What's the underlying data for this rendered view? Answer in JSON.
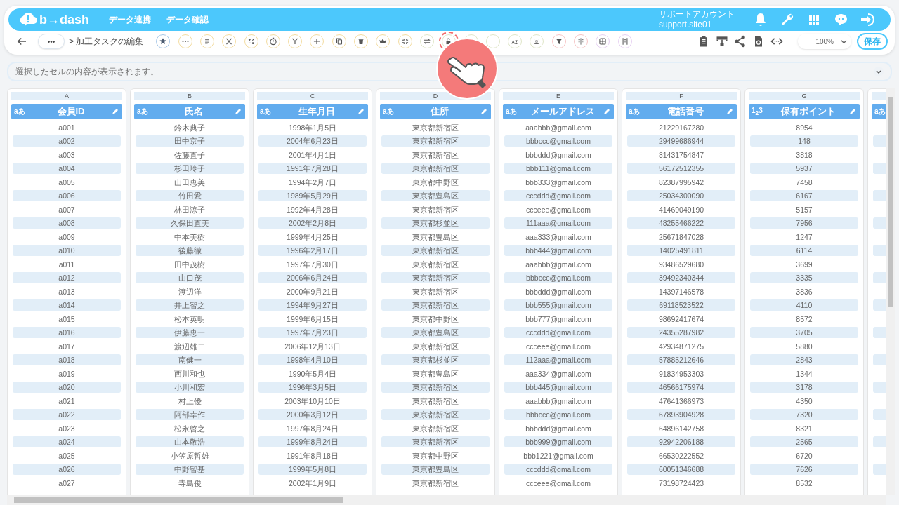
{
  "header": {
    "logo": "b→dash",
    "nav": [
      "データ連携",
      "データ確認"
    ],
    "account": {
      "name": "サポートアカウント",
      "id": "support.site01"
    },
    "icons": [
      {
        "kind": "bell"
      },
      {
        "kind": "wrench"
      },
      {
        "kind": "apps"
      },
      {
        "kind": "chat"
      },
      {
        "kind": "logout"
      }
    ]
  },
  "toolbar": {
    "more": "•••",
    "breadcrumb": "> 加工タスクの編集",
    "tools": [
      {
        "kind": "star",
        "color": "#a8c8e8",
        "highlighted": false
      },
      {
        "kind": "dots",
        "color": "#f3dca0",
        "highlighted": false
      },
      {
        "kind": "lines",
        "color": "#f3dca0",
        "highlighted": false
      },
      {
        "kind": "scissors",
        "color": "#f3dca0",
        "highlighted": false
      },
      {
        "kind": "calc",
        "color": "#f3dca0",
        "highlighted": false
      },
      {
        "kind": "timer",
        "color": "#f3dca0",
        "highlighted": false
      },
      {
        "kind": "merge",
        "color": "#f3dca0",
        "highlighted": false
      },
      {
        "kind": "plus",
        "color": "#f3dca0",
        "highlighted": false
      },
      {
        "kind": "copy",
        "color": "#f3dca0",
        "highlighted": false
      },
      {
        "kind": "trash",
        "color": "#f3dca0",
        "highlighted": false
      },
      {
        "kind": "crown",
        "color": "#f3dca0",
        "highlighted": false
      },
      {
        "kind": "collapse",
        "color": "#f3dca0",
        "highlighted": false
      },
      {
        "kind": "swap",
        "color": "#dfe6c8",
        "highlighted": false
      },
      {
        "kind": "lock",
        "color": "#dfe6c8",
        "highlighted": true
      },
      {
        "kind": "blank",
        "color": "#dfe6c8",
        "highlighted": false
      },
      {
        "kind": "blank",
        "color": "#dfe6c8",
        "highlighted": false
      },
      {
        "kind": "az",
        "color": "#dfe6c8",
        "highlighted": false
      },
      {
        "kind": "box",
        "color": "#dfe6c8",
        "highlighted": false
      },
      {
        "kind": "filter",
        "color": "#f6c4c4",
        "highlighted": false
      },
      {
        "kind": "split",
        "color": "#f6c4c4",
        "highlighted": false
      },
      {
        "kind": "grid",
        "color": "#e6d0f2",
        "highlighted": false
      },
      {
        "kind": "column",
        "color": "#e6d0f2",
        "highlighted": false
      }
    ],
    "right_icons": [
      {
        "kind": "clipboard"
      },
      {
        "kind": "hierarchy"
      },
      {
        "kind": "share"
      },
      {
        "kind": "restore"
      },
      {
        "kind": "code"
      }
    ],
    "zoom": "100%",
    "save": "保存"
  },
  "cell_bar": {
    "placeholder": "選択したセルの内容が表示されます。"
  },
  "table": {
    "columns": [
      {
        "letter": "A",
        "name": "会員ID",
        "type_badge": "aあ"
      },
      {
        "letter": "B",
        "name": "氏名",
        "type_badge": "aあ"
      },
      {
        "letter": "C",
        "name": "生年月日",
        "type_badge": "aあ"
      },
      {
        "letter": "D",
        "name": "住所",
        "type_badge": "aあ"
      },
      {
        "letter": "E",
        "name": "メールアドレス",
        "type_badge": "aあ"
      },
      {
        "letter": "F",
        "name": "電話番号",
        "type_badge": "aあ"
      },
      {
        "letter": "G",
        "name": "保有ポイント",
        "type_badge": "1$_{2}$3"
      },
      {
        "type_badge": "aあ"
      }
    ],
    "rows": [
      [
        "a001",
        "鈴木典子",
        "1998年1月5日",
        "東京都新宿区",
        "aaabbb@gmail.com",
        "21229167280",
        "8954"
      ],
      [
        "a002",
        "田中京子",
        "2004年6月23日",
        "東京都新宿区",
        "bbbccc@gmail.com",
        "29499686944",
        "148"
      ],
      [
        "a003",
        "佐藤直子",
        "2001年4月1日",
        "東京都新宿区",
        "bbbddd@gmail.com",
        "81431754847",
        "3818"
      ],
      [
        "a004",
        "杉田玲子",
        "1991年7月28日",
        "東京都新宿区",
        "bbb111@gmail.com",
        "56172512355",
        "5937"
      ],
      [
        "a005",
        "山田恵美",
        "1994年2月7日",
        "東京都中野区",
        "bbb333@gmail.com",
        "82387995942",
        "7458"
      ],
      [
        "a006",
        "竹田愛",
        "1989年5月29日",
        "東京都豊島区",
        "cccddd@gmail.com",
        "25034300090",
        "6167"
      ],
      [
        "a007",
        "林田涼子",
        "1992年4月28日",
        "東京都新宿区",
        "ccceee@gmail.com",
        "41469049190",
        "5157"
      ],
      [
        "a008",
        "久保田直美",
        "2002年2月8日",
        "東京都杉並区",
        "111aaa@gmail.com",
        "48255466222",
        "7956"
      ],
      [
        "a009",
        "中本美樹",
        "1999年4月25日",
        "東京都豊島区",
        "aaa333@gmail.com",
        "25671847028",
        "1247"
      ],
      [
        "a010",
        "後藤徹",
        "1996年2月17日",
        "東京都新宿区",
        "bbb444@gmail.com",
        "14025491811",
        "6114"
      ],
      [
        "a011",
        "田中茂樹",
        "1997年7月30日",
        "東京都新宿区",
        "aaabbb@gmail.com",
        "93486529680",
        "3699"
      ],
      [
        "a012",
        "山口茂",
        "2006年6月24日",
        "東京都新宿区",
        "bbbccc@gmail.com",
        "39492340344",
        "3335"
      ],
      [
        "a013",
        "渡辺洋",
        "2000年9月21日",
        "東京都新宿区",
        "bbbddd@gmail.com",
        "14397146578",
        "3836"
      ],
      [
        "a014",
        "井上智之",
        "1994年9月27日",
        "東京都新宿区",
        "bbb555@gmail.com",
        "69118523522",
        "4110"
      ],
      [
        "a015",
        "松本英明",
        "1999年6月15日",
        "東京都中野区",
        "bbb777@gmail.com",
        "98692417674",
        "8572"
      ],
      [
        "a016",
        "伊藤恵一",
        "1997年7月23日",
        "東京都豊島区",
        "cccddd@gmail.com",
        "24355287982",
        "3705"
      ],
      [
        "a017",
        "渡辺雄二",
        "2006年12月13日",
        "東京都新宿区",
        "ccceee@gmail.com",
        "42934871275",
        "5880"
      ],
      [
        "a018",
        "南健一",
        "1998年4月10日",
        "東京都杉並区",
        "112aaa@gmail.com",
        "57885212646",
        "2843"
      ],
      [
        "a019",
        "西川和也",
        "1990年5月4日",
        "東京都豊島区",
        "aaa334@gmail.com",
        "91834953303",
        "1344"
      ],
      [
        "a020",
        "小川和宏",
        "1996年3月5日",
        "東京都新宿区",
        "bbb445@gmail.com",
        "46566175974",
        "3178"
      ],
      [
        "a021",
        "村上優",
        "2003年10月10日",
        "東京都新宿区",
        "aaabbb@gmail.com",
        "47641366973",
        "4350"
      ],
      [
        "a022",
        "阿部幸作",
        "2000年3月12日",
        "東京都新宿区",
        "bbbccc@gmail.com",
        "67893904928",
        "7320"
      ],
      [
        "a023",
        "松永啓之",
        "1997年8月24日",
        "東京都新宿区",
        "bbbddd@gmail.com",
        "64896142758",
        "8321"
      ],
      [
        "a024",
        "山本敬浩",
        "1999年8月24日",
        "東京都新宿区",
        "bbb999@gmail.com",
        "92942206188",
        "2565"
      ],
      [
        "a025",
        "小笠原哲雄",
        "1991年8月18日",
        "東京都中野区",
        "bbb1221@gmail.com",
        "66530222552",
        "6720"
      ],
      [
        "a026",
        "中野智基",
        "1999年5月8日",
        "東京都豊島区",
        "cccddd@gmail.com",
        "60051346688",
        "7626"
      ],
      [
        "a027",
        "寺島俊",
        "2002年1月9日",
        "東京都新宿区",
        "ccceee@gmail.com",
        "73198724423",
        "8532"
      ]
    ]
  }
}
